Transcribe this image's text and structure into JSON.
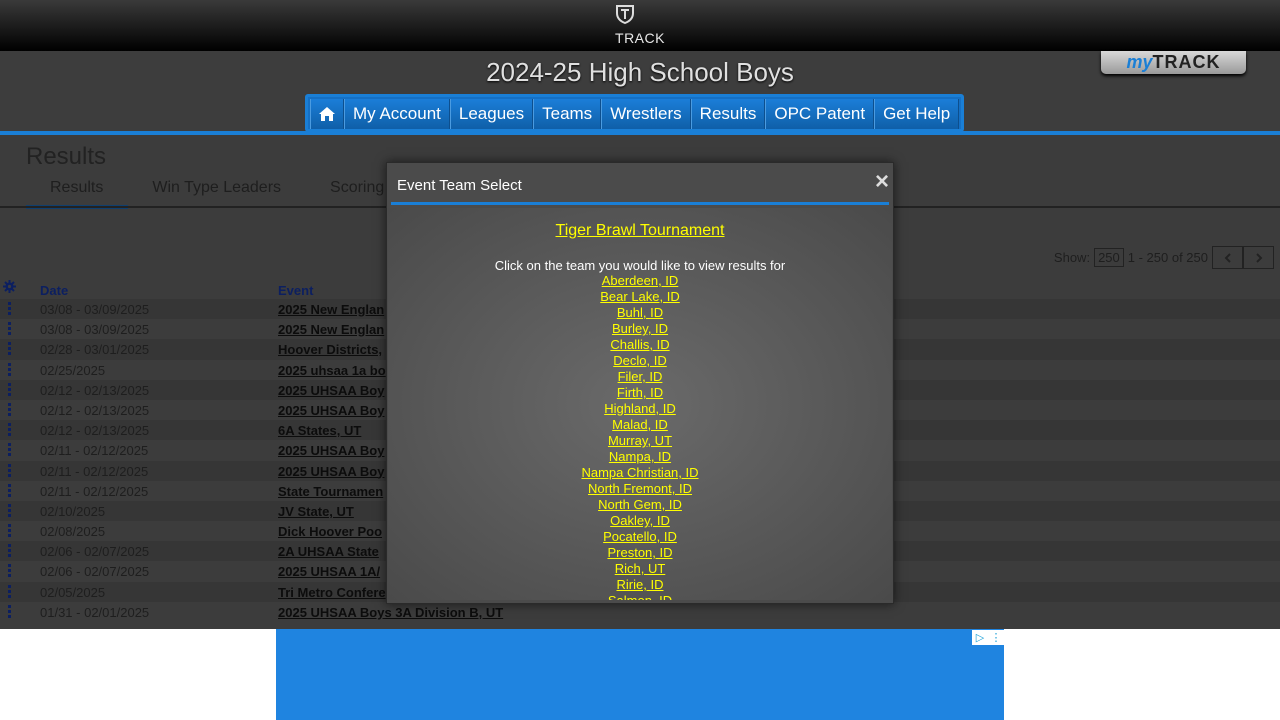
{
  "app": {
    "brand": "TRACK",
    "title": "2024-25 High School Boys",
    "mytrack_prefix": "my",
    "mytrack_suffix": "TRACK"
  },
  "nav": [
    "My Account",
    "Leagues",
    "Teams",
    "Wrestlers",
    "Results",
    "OPC Patent",
    "Get Help"
  ],
  "page": {
    "title": "Results",
    "tabs": [
      "Results",
      "Win Type Leaders",
      "Scoring"
    ],
    "pager": {
      "show_label": "Show:",
      "show_value": "250",
      "range": "1 - 250 of 250"
    },
    "columns": {
      "date": "Date",
      "event": "Event"
    }
  },
  "rows": [
    {
      "date": "03/08 - 03/09/2025",
      "event": "2025 New Englan"
    },
    {
      "date": "03/08 - 03/09/2025",
      "event": "2025 New Englan"
    },
    {
      "date": "02/28 - 03/01/2025",
      "event": "Hoover Districts,"
    },
    {
      "date": "02/25/2025",
      "event": "2025 uhsaa 1a bo"
    },
    {
      "date": "02/12 - 02/13/2025",
      "event": "2025 UHSAA Boy"
    },
    {
      "date": "02/12 - 02/13/2025",
      "event": "2025 UHSAA Boy"
    },
    {
      "date": "02/12 - 02/13/2025",
      "event": "6A States, UT"
    },
    {
      "date": "02/11 - 02/12/2025",
      "event": "2025 UHSAA Boy"
    },
    {
      "date": "02/11 - 02/12/2025",
      "event": "2025 UHSAA Boy"
    },
    {
      "date": "02/11 - 02/12/2025",
      "event": "State Tournamen"
    },
    {
      "date": "02/10/2025",
      "event": "JV State, UT"
    },
    {
      "date": "02/08/2025",
      "event": "Dick Hoover Poo"
    },
    {
      "date": "02/06 - 02/07/2025",
      "event": "2A UHSAA State"
    },
    {
      "date": "02/06 - 02/07/2025",
      "event": "2025 UHSAA 1A/"
    },
    {
      "date": "02/05/2025",
      "event": "Tri Metro Confere"
    },
    {
      "date": "01/31 - 02/01/2025",
      "event": "2025 UHSAA Boys 3A Division B, UT"
    }
  ],
  "modal": {
    "title": "Event Team Select",
    "close": "×",
    "tournament": "Tiger Brawl Tournament",
    "instructions": "Click on the team you would like to view results for",
    "teams": [
      "Aberdeen, ID",
      "Bear Lake, ID",
      "Buhl, ID",
      "Burley, ID",
      "Challis, ID",
      "Declo, ID",
      "Filer, ID",
      "Firth, ID",
      "Highland, ID",
      "Malad, ID",
      "Murray, UT",
      "Nampa, ID",
      "Nampa Christian, ID",
      "North Fremont, ID",
      "North Gem, ID",
      "Oakley, ID",
      "Pocatello, ID",
      "Preston, ID",
      "Rich, UT",
      "Ririe, ID",
      "Salmon, ID"
    ]
  },
  "icons": {
    "logo": "track-shield-icon",
    "home": "home-icon",
    "settings": "gear-icon",
    "prev": "chevron-left-icon",
    "next": "chevron-right-icon",
    "ad_choices": "adchoices-icon",
    "ad_menu": "kebab-icon"
  },
  "colors": {
    "accent": "#1a7fd6",
    "link": "#ffff00"
  }
}
